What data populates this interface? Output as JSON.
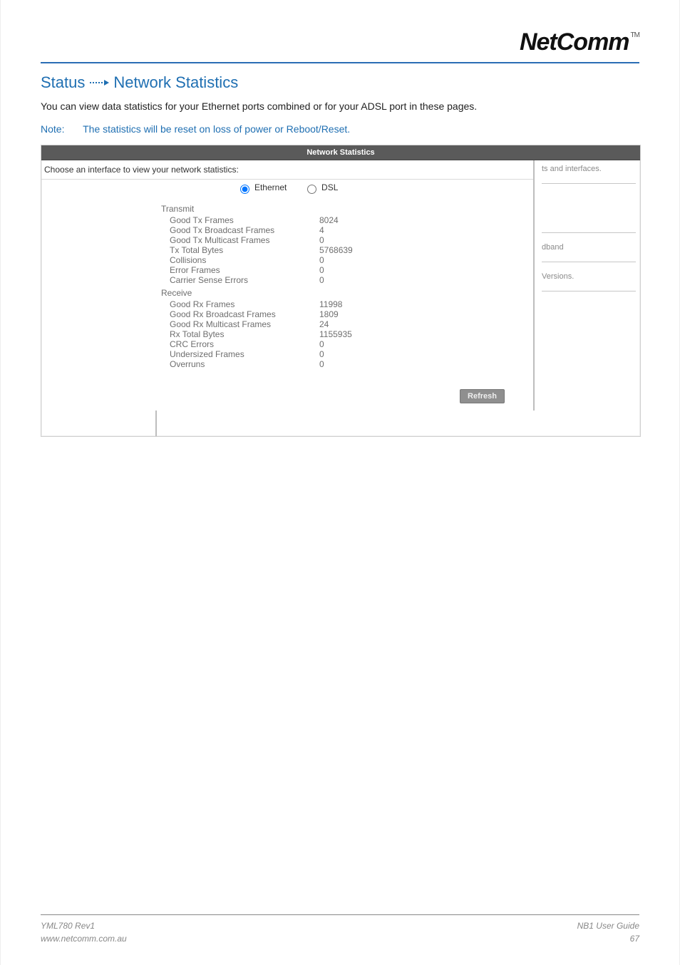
{
  "header": {
    "brand": "NetComm",
    "tm": "TM"
  },
  "heading": {
    "part1": "Status",
    "part2": "Network Statistics"
  },
  "paragraph": "You can view data statistics for your Ethernet ports combined or for your ADSL port in these pages.",
  "note": {
    "label": "Note:",
    "text": "The statistics will be reset on loss of power or Reboot/Reset."
  },
  "screenshot": {
    "title": "Network Statistics",
    "choose": "Choose an interface to view your network statistics:",
    "radios": {
      "ethernet": "Ethernet",
      "dsl": "DSL"
    },
    "transmit": {
      "label": "Transmit",
      "rows": [
        {
          "k": "Good Tx Frames",
          "v": "8024"
        },
        {
          "k": "Good Tx Broadcast Frames",
          "v": "4"
        },
        {
          "k": "Good Tx Multicast Frames",
          "v": "0"
        },
        {
          "k": "Tx Total Bytes",
          "v": "5768639"
        },
        {
          "k": "Collisions",
          "v": "0"
        },
        {
          "k": "Error Frames",
          "v": "0"
        },
        {
          "k": "Carrier Sense Errors",
          "v": "0"
        }
      ]
    },
    "receive": {
      "label": "Receive",
      "rows": [
        {
          "k": "Good Rx Frames",
          "v": "11998"
        },
        {
          "k": "Good Rx Broadcast Frames",
          "v": "1809"
        },
        {
          "k": "Good Rx Multicast Frames",
          "v": "24"
        },
        {
          "k": "Rx Total Bytes",
          "v": "1155935"
        },
        {
          "k": "CRC Errors",
          "v": "0"
        },
        {
          "k": "Undersized Frames",
          "v": "0"
        },
        {
          "k": "Overruns",
          "v": "0"
        }
      ]
    },
    "refresh": "Refresh",
    "side": {
      "line1": "ts and interfaces.",
      "line2": "dband",
      "line3": "Versions."
    }
  },
  "footer": {
    "left1": "YML780 Rev1",
    "left2": "www.netcomm.com.au",
    "right1": "NB1 User Guide",
    "right2": "67"
  }
}
